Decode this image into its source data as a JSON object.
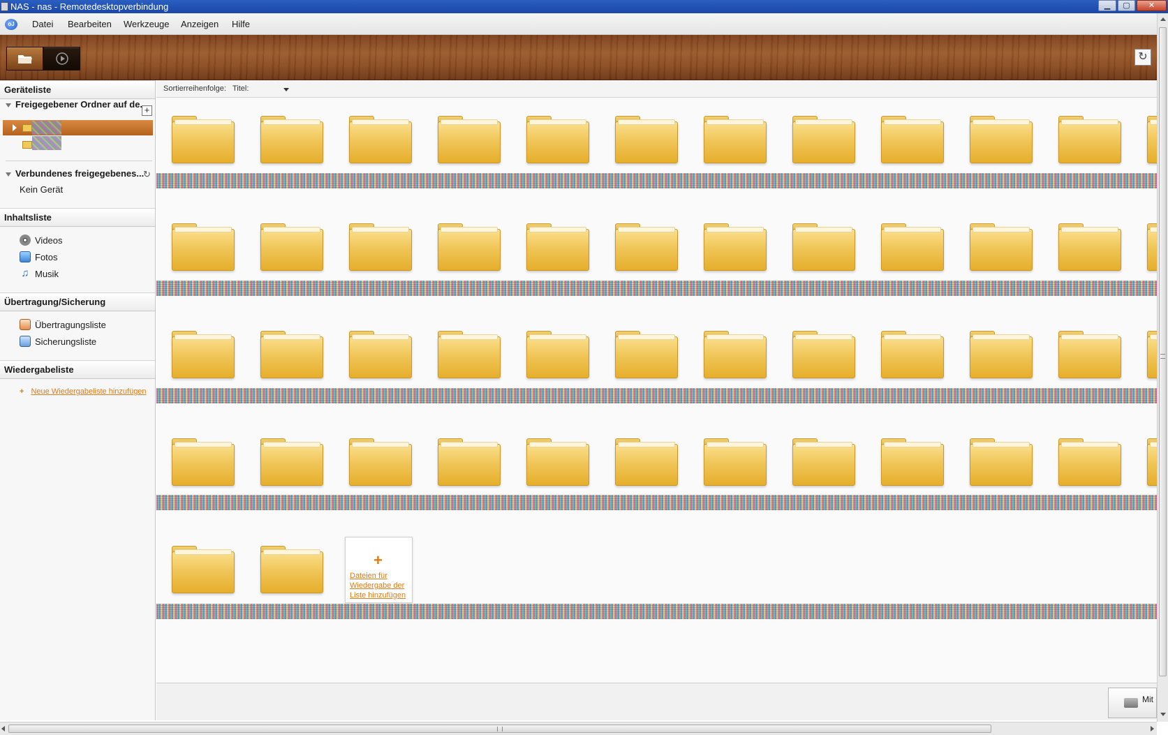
{
  "window": {
    "title": "NAS - nas - Remotedesktopverbindung",
    "buttons": [
      "minimize",
      "maximize",
      "close"
    ]
  },
  "menubar": {
    "items": [
      "Datei",
      "Bearbeiten",
      "Werkzeuge",
      "Anzeigen",
      "Hilfe"
    ]
  },
  "toolbar": {
    "buttons": [
      {
        "name": "folder-view",
        "icon": "folder-icon",
        "active": true
      },
      {
        "name": "play-view",
        "icon": "play-icon",
        "active": false
      }
    ],
    "refresh_icon": "refresh-icon"
  },
  "sidebar": {
    "device_list": {
      "title": "Geräteliste",
      "shared_folder_header": "Freigegebener Ordner auf de...",
      "connected_header": "Verbundenes freigegebenes...",
      "no_device": "Kein Gerät"
    },
    "content_list": {
      "title": "Inhaltsliste",
      "items": [
        {
          "label": "Videos",
          "icon": "film-reel-icon"
        },
        {
          "label": "Fotos",
          "icon": "photo-icon"
        },
        {
          "label": "Musik",
          "icon": "music-note-icon"
        }
      ]
    },
    "transfer": {
      "title": "Übertragung/Sicherung",
      "items": [
        {
          "label": "Übertragungsliste",
          "icon": "transfer-icon"
        },
        {
          "label": "Sicherungsliste",
          "icon": "backup-icon"
        }
      ]
    },
    "playlist": {
      "title": "Wiedergabeliste",
      "add_label": "Neue Wiedergabeliste hinzufügen"
    }
  },
  "sortbar": {
    "label": "Sortierreihenfolge:",
    "value": "Titel:"
  },
  "content": {
    "add_card_label": "Dateien für Wiedergabe der Liste hinzufügen",
    "add_card_plus": "+"
  },
  "bottom": {
    "share_button_label": "Mit Ge..."
  },
  "colors": {
    "accent": "#e07b16",
    "selection": "#c06e29",
    "wood": "#8a4b20",
    "folder": "#f0c659"
  }
}
